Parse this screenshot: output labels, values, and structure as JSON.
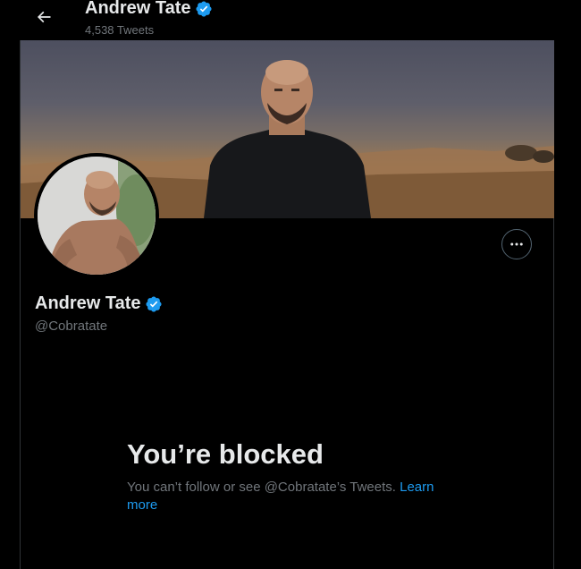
{
  "header": {
    "name": "Andrew Tate",
    "tweet_count": "4,538 Tweets"
  },
  "profile": {
    "name": "Andrew Tate",
    "handle": "@Cobratate",
    "verified": true
  },
  "blocked": {
    "title": "You’re blocked",
    "message": "You can’t follow or see @Cobratate’s Tweets.",
    "link": "Learn more"
  },
  "icons": {
    "back": "arrow-left-icon",
    "verified": "verified-badge-icon",
    "more": "more-options-icon"
  },
  "colors": {
    "background": "#000000",
    "accent": "#1d9bf0",
    "text_primary": "#e7e9ea",
    "text_secondary": "#71767b"
  }
}
